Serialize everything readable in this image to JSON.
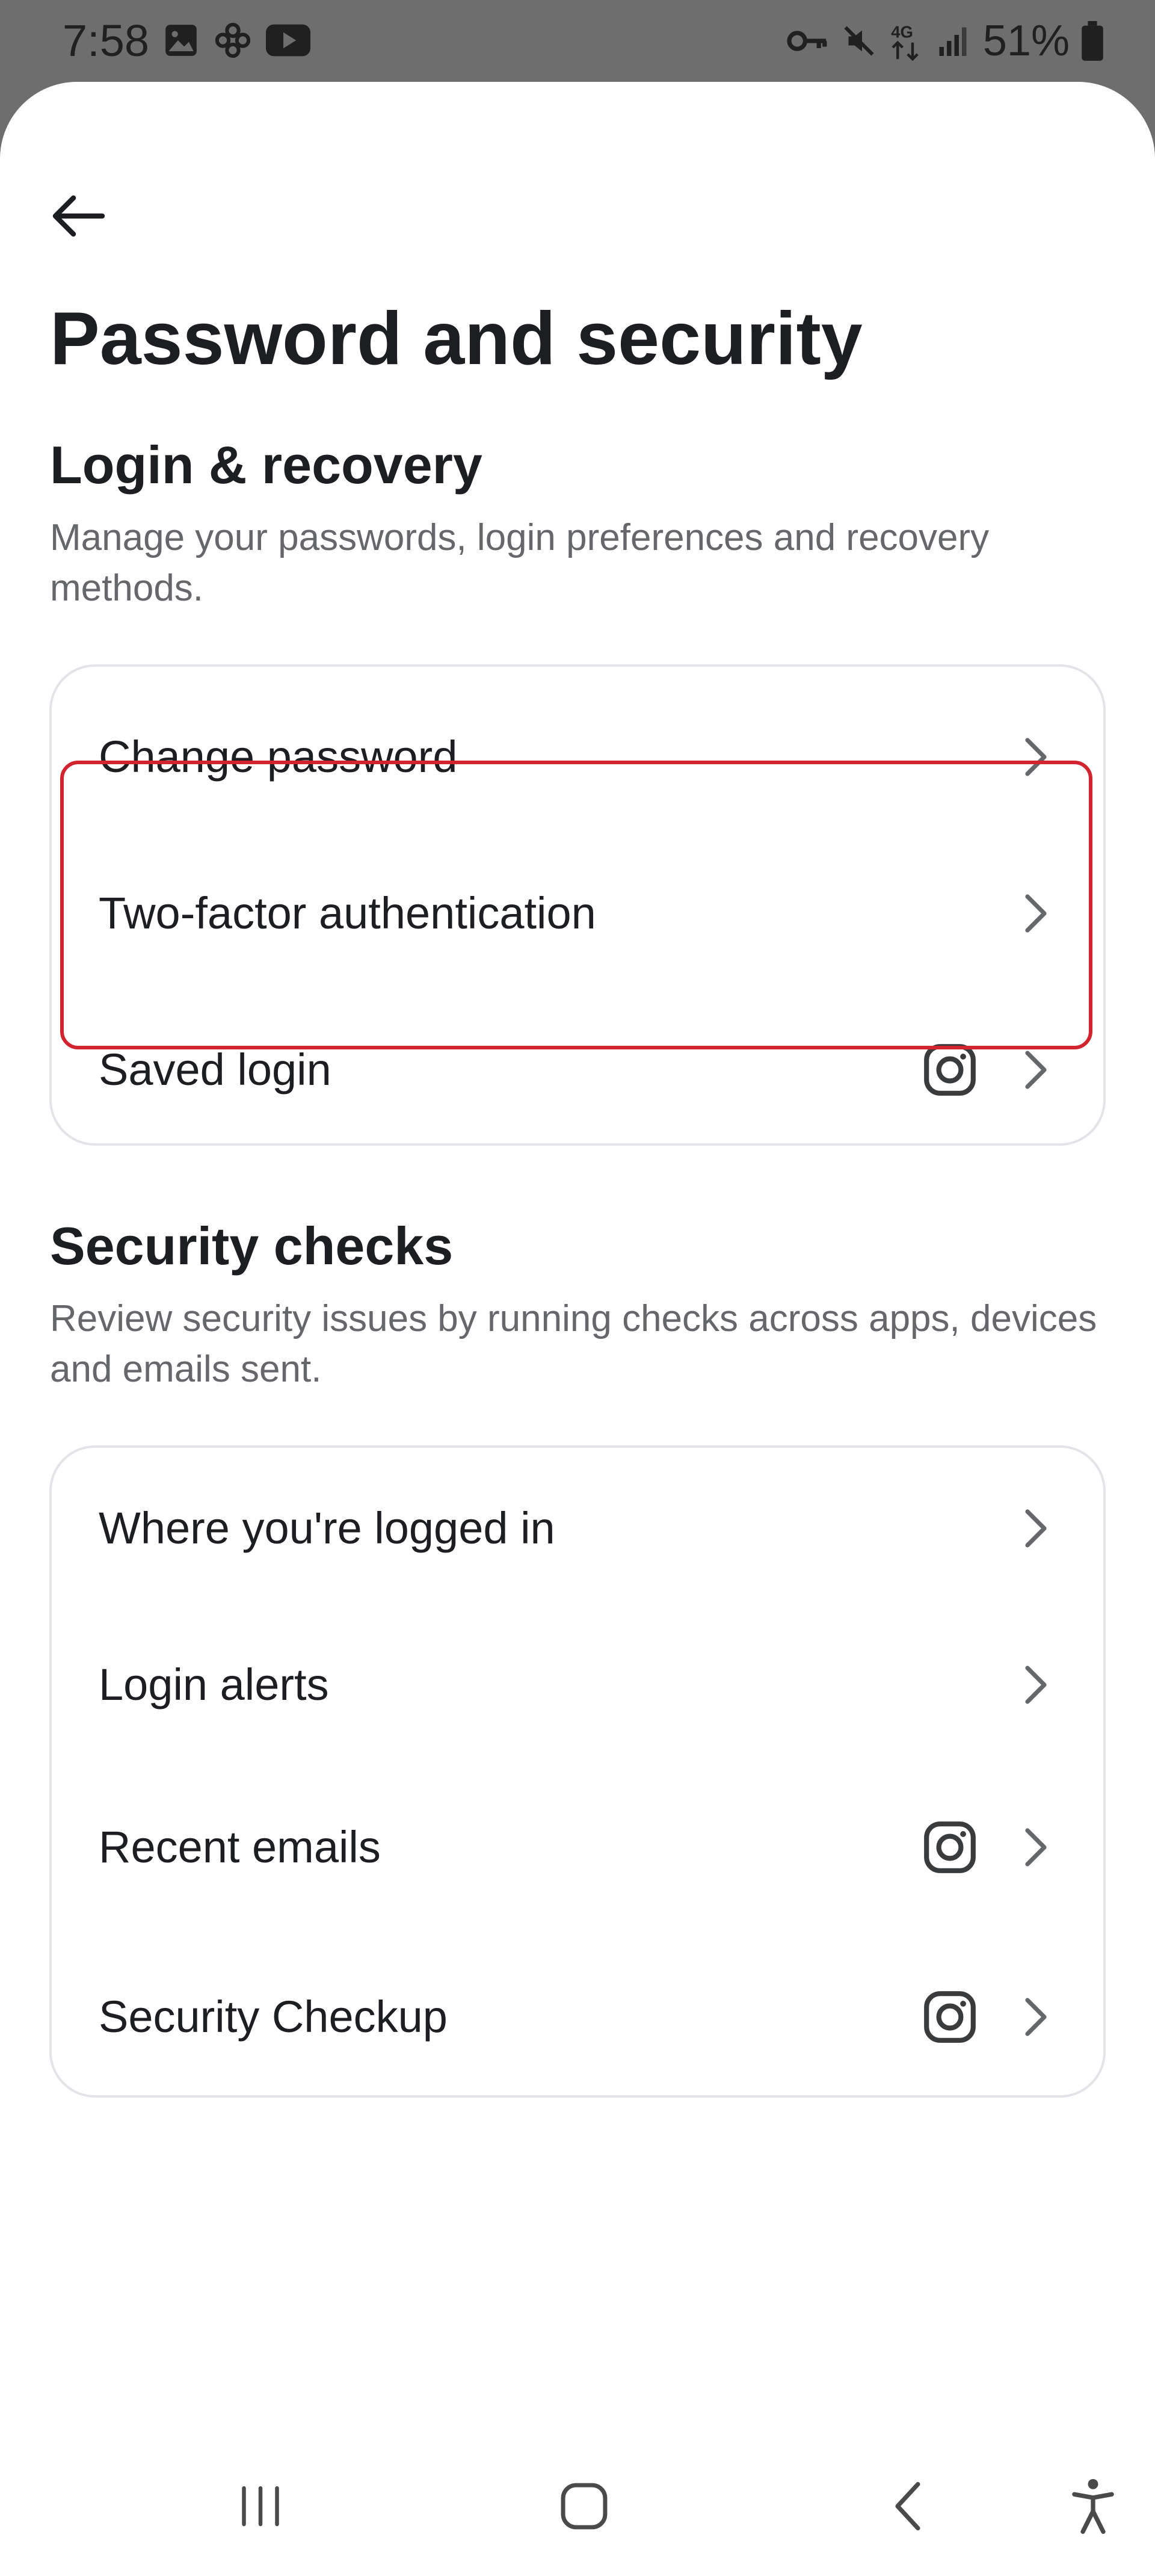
{
  "status_bar": {
    "time": "7:58",
    "battery": "51%",
    "left_icons": [
      "gallery-icon",
      "pinwheel-icon",
      "youtube-icon"
    ],
    "right_icons": [
      "vpn-key-icon",
      "mute-icon",
      "network-4g-icon",
      "signal-icon",
      "battery-icon"
    ]
  },
  "header": {
    "title": "Password and security"
  },
  "login_recovery": {
    "title": "Login & recovery",
    "description": "Manage your passwords, login preferences and recovery methods.",
    "items": [
      {
        "label": "Change password",
        "has_instagram_icon": false
      },
      {
        "label": "Two-factor authentication",
        "has_instagram_icon": false
      },
      {
        "label": "Saved login",
        "has_instagram_icon": true
      }
    ]
  },
  "security_checks": {
    "title": "Security checks",
    "description": "Review security issues by running checks across apps, devices and emails sent.",
    "items": [
      {
        "label": "Where you're logged in",
        "has_instagram_icon": false
      },
      {
        "label": "Login alerts",
        "has_instagram_icon": false
      },
      {
        "label": "Recent emails",
        "has_instagram_icon": true
      },
      {
        "label": "Security Checkup",
        "has_instagram_icon": true
      }
    ]
  },
  "nav_bar": {
    "buttons": [
      "recent-apps-icon",
      "home-icon",
      "back-icon",
      "accessibility-icon"
    ]
  },
  "colors": {
    "highlight": "#d1242f",
    "text_primary": "#1c1e21",
    "text_secondary": "#65676b",
    "card_border": "#e2e4e8",
    "status_bar_bg": "#6e6e6e"
  }
}
